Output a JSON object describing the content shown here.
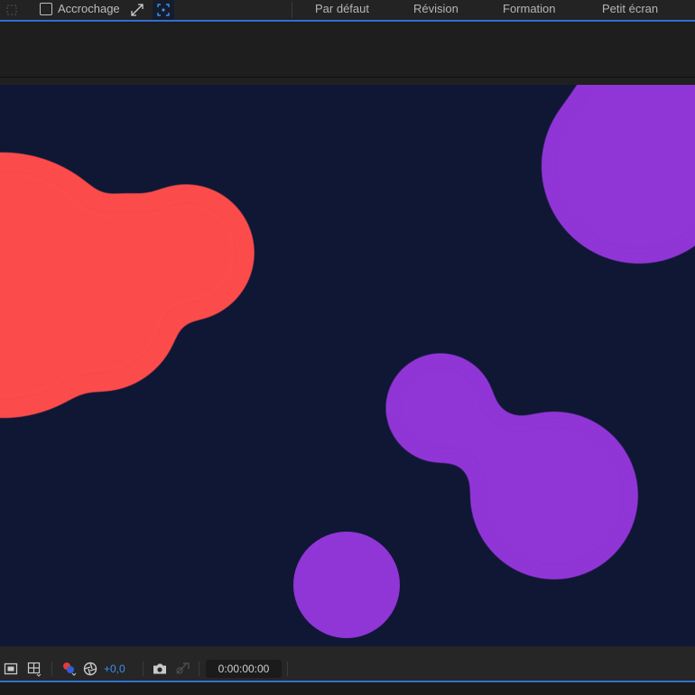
{
  "toolbar": {
    "snap_label": "Accrochage",
    "snap_checked": false,
    "icons": [
      "selection-tool-icon",
      "snap-edge-icon",
      "snap-features-icon"
    ],
    "workspaces": [
      "Par défaut",
      "Révision",
      "Formation",
      "Petit écran"
    ]
  },
  "viewer_bar": {
    "exposure": "+0,0",
    "timecode": "0:00:00:00",
    "icons": [
      "region-of-interest-icon",
      "grid-guides-icon",
      "color-channels-icon",
      "reset-exposure-icon",
      "snapshot-camera-icon",
      "show-snapshot-icon"
    ]
  },
  "composition": {
    "background_color": "#0f1734",
    "shapes": [
      {
        "name": "red-blob",
        "color": "#fc4c4c"
      },
      {
        "name": "purple-circle-top-right",
        "color": "#9035d6"
      },
      {
        "name": "purple-blob-right",
        "color": "#9035d6"
      },
      {
        "name": "purple-circle-bottom",
        "color": "#9035d6"
      }
    ]
  },
  "theme": {
    "accent": "#2f6fd1",
    "exposure_text": "#3d8ef0",
    "panel_bg": "#1e1e1e"
  }
}
